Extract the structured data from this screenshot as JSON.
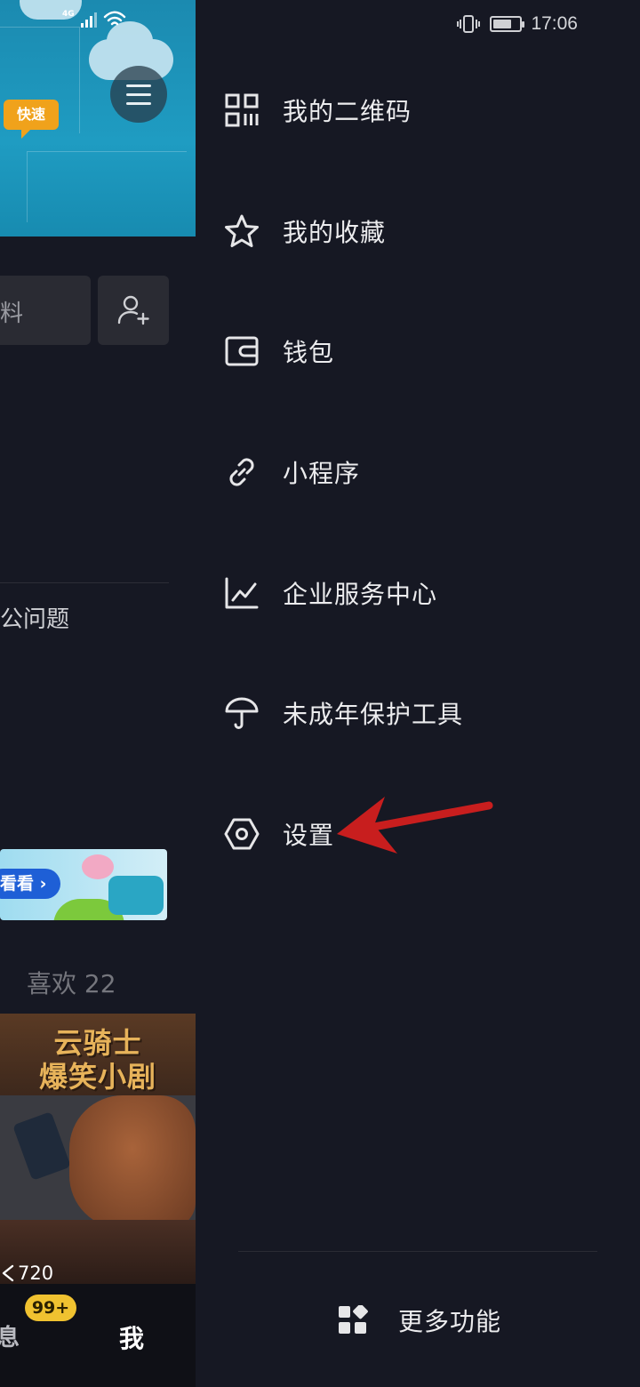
{
  "status_bar": {
    "network": "4G",
    "time": "17:06",
    "battery_level": 0.7
  },
  "background_app": {
    "banner_tag": "快速",
    "profile_field_text": "料",
    "faq_text": "公问题",
    "promo_button": "看看",
    "likes_tab": "喜欢 22",
    "video": {
      "title_line1": "云骑士",
      "title_line2": "爆笑小剧",
      "play_count": "720"
    },
    "bottom_nav": {
      "messages_label": "消息",
      "messages_badge": "99+",
      "me_label": "我"
    }
  },
  "drawer": {
    "items": [
      {
        "label": "我的二维码",
        "icon": "qr-code-icon"
      },
      {
        "label": "我的收藏",
        "icon": "star-icon"
      },
      {
        "label": "钱包",
        "icon": "wallet-icon"
      },
      {
        "label": "小程序",
        "icon": "link-icon"
      },
      {
        "label": "企业服务中心",
        "icon": "chart-line-icon"
      },
      {
        "label": "未成年保护工具",
        "icon": "umbrella-icon"
      },
      {
        "label": "设置",
        "icon": "hexagon-settings-icon"
      }
    ],
    "more_features_label": "更多功能"
  },
  "annotation": {
    "arrow_color": "#c81e1e",
    "points_to": "设置"
  }
}
